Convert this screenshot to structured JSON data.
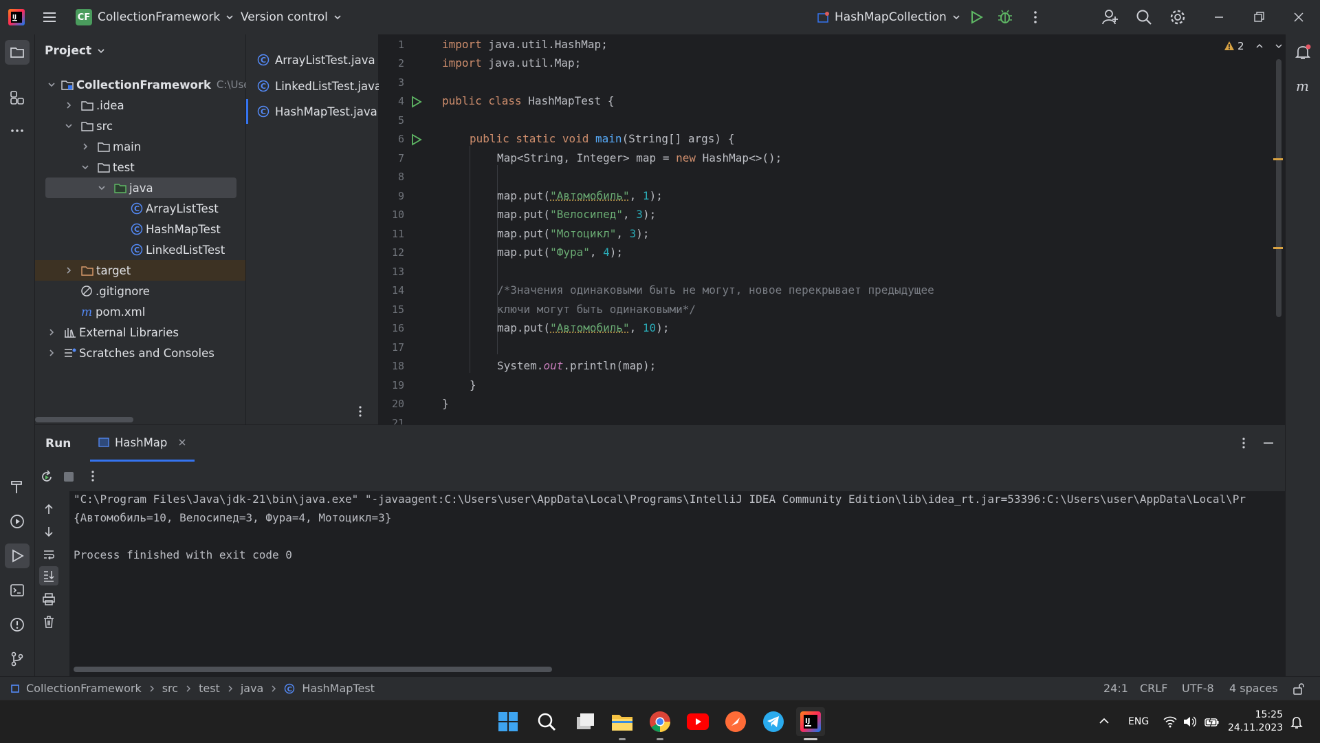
{
  "titlebar": {
    "project_badge": "CF",
    "project_name": "CollectionFramework",
    "vcs": "Version control",
    "run_config": "HashMapCollection"
  },
  "project_panel": {
    "title": "Project",
    "root": {
      "name": "CollectionFramework",
      "path": "C:\\Use"
    },
    "items": [
      {
        "label": ".idea"
      },
      {
        "label": "src"
      },
      {
        "label": "main"
      },
      {
        "label": "test"
      },
      {
        "label": "java"
      },
      {
        "label": "ArrayListTest"
      },
      {
        "label": "HashMapTest"
      },
      {
        "label": "LinkedListTest"
      },
      {
        "label": "target"
      },
      {
        "label": ".gitignore"
      },
      {
        "label": "pom.xml"
      },
      {
        "label": "External Libraries"
      },
      {
        "label": "Scratches and Consoles"
      }
    ]
  },
  "open_files": [
    "ArrayListTest.java",
    "LinkedListTest.java",
    "HashMapTest.java"
  ],
  "editor": {
    "warnings": "2",
    "lines": [
      "1",
      "2",
      "3",
      "4",
      "5",
      "6",
      "7",
      "8",
      "9",
      "10",
      "11",
      "12",
      "13",
      "14",
      "15",
      "16",
      "17",
      "18",
      "19",
      "20",
      "21"
    ],
    "code": {
      "l1a": "import",
      "l1b": " java.util.HashMap;",
      "l2a": "import",
      "l2b": " java.util.Map;",
      "l4a": "public class",
      "l4b": " HashMapTest {",
      "l6a": "public static void",
      "l6b": "main",
      "l6c": "(String[] args) {",
      "l7a": "Map<String, Integer> map = ",
      "l7b": "new",
      "l7c": " HashMap<>();",
      "put": "map.put(",
      "s1": "\"Автомобиль\"",
      "n1": "1",
      "s2": "\"Велосипед\"",
      "n2": "3",
      "s3": "\"Мотоцикл\"",
      "n3": "3",
      "s4": "\"Фура\"",
      "n4": "4",
      "c1": "/*Значения одинаковыми быть не могут, новое перекрывает предыдущее",
      "c2": "ключи могут быть одинаковыми*/",
      "s5": "\"Автомобиль\"",
      "n5": "10",
      "sep": ", ",
      "end": ");",
      "l18a": "System.",
      "l18b": "out",
      "l18c": ".println(map);",
      "close": "}"
    }
  },
  "run": {
    "title": "Run",
    "tab": "HashMap",
    "console": [
      "\"C:\\Program Files\\Java\\jdk-21\\bin\\java.exe\" \"-javaagent:C:\\Users\\user\\AppData\\Local\\Programs\\IntelliJ IDEA Community Edition\\lib\\idea_rt.jar=53396:C:\\Users\\user\\AppData\\Local\\Pr",
      "{Автомобиль=10, Велосипед=3, Фура=4, Мотоцикл=3}",
      "",
      "Process finished with exit code 0"
    ]
  },
  "statusbar": {
    "breadcrumb": [
      "CollectionFramework",
      "src",
      "test",
      "java",
      "HashMapTest"
    ],
    "position": "24:1",
    "line_sep": "CRLF",
    "encoding": "UTF-8",
    "indent": "4 spaces"
  },
  "taskbar": {
    "lang": "ENG",
    "time": "15:25",
    "date": "24.11.2023"
  },
  "colors": {
    "accent": "#3574f0",
    "class_icon": "#548af7",
    "run_green": "#5fb865",
    "selection": "#43454a",
    "excluded": "#3d3223"
  }
}
